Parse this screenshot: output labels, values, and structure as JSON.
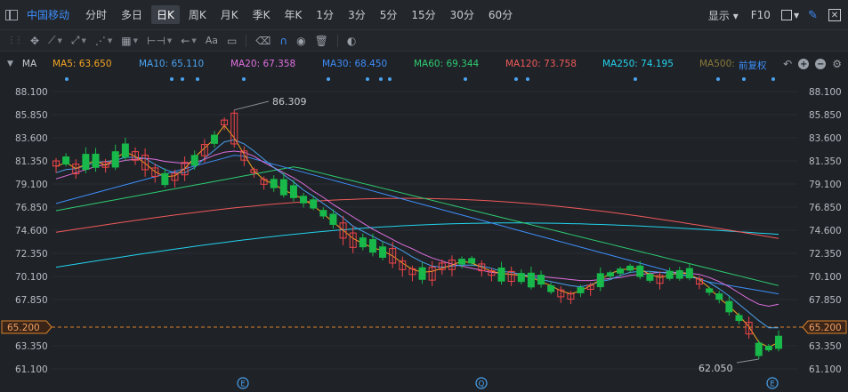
{
  "toolbar_top": {
    "stock_name": "中国移动",
    "periods": [
      "分时",
      "多日",
      "日K",
      "周K",
      "月K",
      "季K",
      "年K",
      "1分",
      "3分",
      "5分",
      "15分",
      "30分",
      "60分"
    ],
    "active_period": "日K",
    "display_label": "显示",
    "f10_label": "F10"
  },
  "drawing_tools": {
    "text_tool_label": "Aa",
    "icons": [
      "crosshair-icon",
      "line-tool-icon",
      "ray-tool-icon",
      "polyline-tool-icon",
      "fib-tool-icon",
      "measure-tool-icon",
      "arrow-tool-icon",
      "text-tool-icon",
      "comment-icon",
      "eraser-icon",
      "magnet-icon",
      "eye-icon",
      "trash-icon",
      "toggle-icon"
    ]
  },
  "ma_bar": {
    "title": "MA",
    "items": [
      {
        "label": "MA5: 63.650",
        "color": "#f5a623"
      },
      {
        "label": "MA10: 65.110",
        "color": "#4aa3f0"
      },
      {
        "label": "MA20: 67.358",
        "color": "#e070e0"
      },
      {
        "label": "MA30: 68.450",
        "color": "#3d8ef8"
      },
      {
        "label": "MA60: 69.344",
        "color": "#2ecc71"
      },
      {
        "label": "MA120: 73.758",
        "color": "#f05a5a"
      },
      {
        "label": "MA250: 74.195",
        "color": "#22d3ee"
      },
      {
        "label": "MA500:",
        "color": "#8a7a3a"
      }
    ],
    "adjust_label": "前复权"
  },
  "chart_data": {
    "type": "candlestick",
    "y_ticks": [
      "88.100",
      "85.850",
      "83.600",
      "81.350",
      "79.100",
      "76.850",
      "74.600",
      "72.350",
      "70.100",
      "67.850",
      "65.200",
      "63.350",
      "61.100"
    ],
    "ylim": [
      61.1,
      88.1
    ],
    "current_price": "65.200",
    "high_label": "86.309",
    "low_label": "62.050",
    "high_value": 86.309,
    "low_value": 62.05,
    "event_markers": [
      "E",
      "Q",
      "E"
    ],
    "colors": {
      "up": "#f0454a",
      "down": "#18b84a",
      "grid": "#2a2e35",
      "price_line": "#d9822b"
    },
    "ma_series": {
      "ma5": [
        80.8,
        81.2,
        80.6,
        81.0,
        81.4,
        80.9,
        81.6,
        82.2,
        81.8,
        81.1,
        80.3,
        79.8,
        79.9,
        80.6,
        81.7,
        82.6,
        83.5,
        84.8,
        83.6,
        82.0,
        80.4,
        79.5,
        79.1,
        78.5,
        78.1,
        77.6,
        77.0,
        76.2,
        75.4,
        74.6,
        73.8,
        73.3,
        72.9,
        72.6,
        72.1,
        71.4,
        70.8,
        70.5,
        70.6,
        70.9,
        71.2,
        71.6,
        71.4,
        71.0,
        70.6,
        70.4,
        70.3,
        70.2,
        70.0,
        69.6,
        69.2,
        68.7,
        68.4,
        68.7,
        69.2,
        69.8,
        70.4,
        70.7,
        70.9,
        70.8,
        70.3,
        70.0,
        70.2,
        70.5,
        70.3,
        69.8,
        69.0,
        68.0,
        67.2,
        66.3,
        65.2,
        63.7,
        63.2,
        63.7
      ],
      "ma10": [
        80.2,
        80.5,
        80.6,
        80.9,
        81.2,
        81.3,
        81.4,
        81.7,
        81.7,
        81.6,
        81.0,
        80.5,
        80.2,
        80.2,
        80.7,
        81.6,
        82.4,
        83.2,
        83.4,
        83.0,
        82.3,
        81.5,
        80.7,
        80.0,
        79.3,
        78.5,
        77.9,
        77.2,
        76.5,
        75.8,
        75.0,
        74.5,
        74.0,
        73.5,
        73.1,
        72.6,
        72.0,
        71.5,
        71.1,
        71.0,
        71.1,
        71.2,
        71.2,
        71.1,
        70.9,
        70.6,
        70.5,
        70.3,
        70.1,
        69.8,
        69.6,
        69.4,
        69.2,
        69.1,
        69.3,
        69.6,
        69.8,
        70.2,
        70.5,
        70.6,
        70.6,
        70.5,
        70.4,
        70.3,
        70.1,
        69.9,
        69.5,
        68.9,
        68.2,
        67.4,
        66.6,
        65.8,
        65.1,
        65.1
      ],
      "ma20": [
        79.6,
        79.9,
        80.2,
        80.5,
        80.8,
        81.0,
        81.2,
        81.4,
        81.5,
        81.6,
        81.5,
        81.3,
        81.2,
        81.1,
        81.2,
        81.5,
        81.9,
        82.2,
        82.3,
        82.2,
        81.8,
        81.2,
        80.7,
        80.2,
        79.7,
        79.1,
        78.4,
        77.8,
        77.1,
        76.5,
        75.9,
        75.3,
        74.7,
        74.2,
        73.7,
        73.2,
        72.8,
        72.3,
        71.9,
        71.6,
        71.3,
        71.1,
        70.9,
        70.7,
        70.5,
        70.4,
        70.3,
        70.2,
        70.2,
        70.1,
        70.0,
        69.9,
        69.8,
        69.7,
        69.7,
        69.8,
        69.9,
        70.0,
        70.2,
        70.3,
        70.4,
        70.5,
        70.5,
        70.5,
        70.4,
        70.3,
        70.0,
        69.6,
        69.1,
        68.5,
        67.9,
        67.4,
        67.2,
        67.4
      ]
    }
  }
}
